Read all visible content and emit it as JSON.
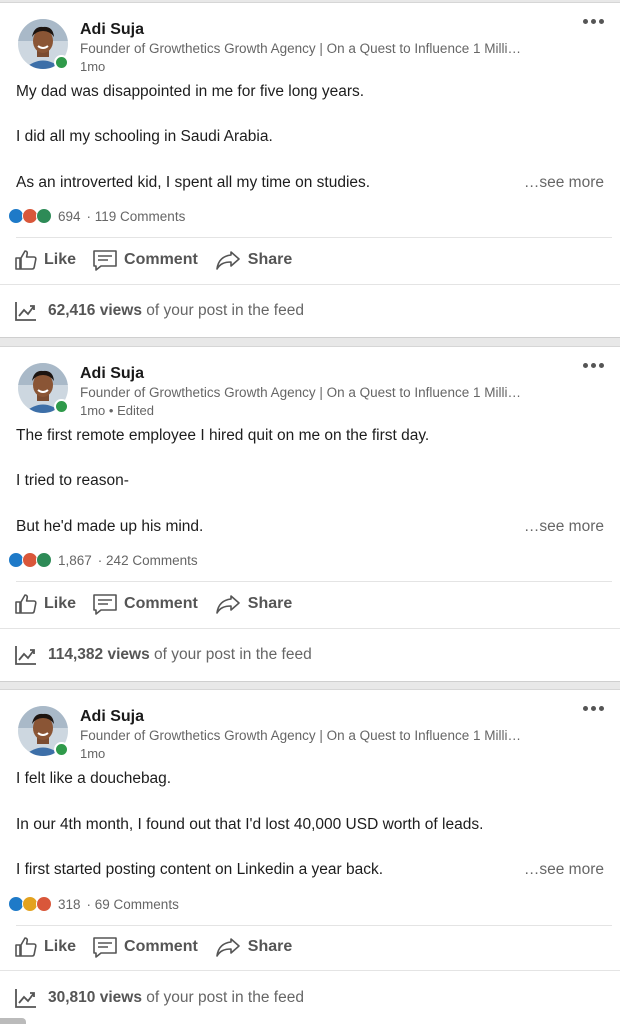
{
  "posts": [
    {
      "author": "Adi Suja",
      "headline": "Founder of Growthetics Growth Agency | On a Quest to Influence 1 Milli…",
      "meta": "1mo",
      "lines": [
        "My dad was disappointed in me for five long years.",
        "I did all my schooling in Saudi Arabia.",
        "As an introverted kid, I spent all my time on studies."
      ],
      "see_more": "…see more",
      "reactions": [
        "like",
        "love",
        "celebrate"
      ],
      "reaction_count": "694",
      "comment_count": "119 Comments",
      "actions": {
        "like": "Like",
        "comment": "Comment",
        "share": "Share"
      },
      "views_count": "62,416 views",
      "views_suffix": "of your post in the feed"
    },
    {
      "author": "Adi Suja",
      "headline": "Founder of Growthetics Growth Agency | On a Quest to Influence 1 Milli…",
      "meta": "1mo • Edited",
      "lines": [
        "The first remote employee I hired quit on me on the first day.",
        "I tried to reason-",
        "But he'd made up his mind."
      ],
      "see_more": "…see more",
      "reactions": [
        "like",
        "love",
        "celebrate"
      ],
      "reaction_count": "1,867",
      "comment_count": "242 Comments",
      "actions": {
        "like": "Like",
        "comment": "Comment",
        "share": "Share"
      },
      "views_count": "114,382 views",
      "views_suffix": "of your post in the feed"
    },
    {
      "author": "Adi Suja",
      "headline": "Founder of Growthetics Growth Agency | On a Quest to Influence 1 Milli…",
      "meta": "1mo",
      "lines": [
        "I felt like a douchebag.",
        "In our 4th month, I found out that I'd lost 40,000 USD worth of leads.",
        "I first started posting content on Linkedin a year back."
      ],
      "see_more": "…see more",
      "reactions": [
        "like",
        "insightful",
        "love"
      ],
      "reaction_count": "318",
      "comment_count": "69 Comments",
      "actions": {
        "like": "Like",
        "comment": "Comment",
        "share": "Share"
      },
      "views_count": "30,810 views",
      "views_suffix": "of your post in the feed"
    }
  ],
  "colors": {
    "like": "#1e7ac8",
    "love": "#d9573a",
    "insightful": "#e3a21f",
    "celebrate": "#2e8b57",
    "presence": "#2f9a4a"
  }
}
